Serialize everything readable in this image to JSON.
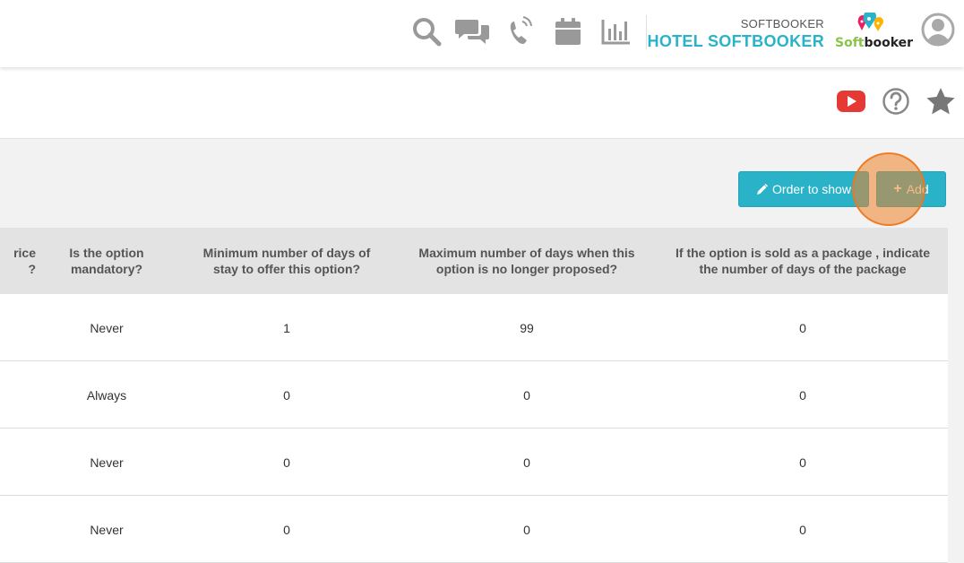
{
  "header": {
    "brand_small": "SOFTBOOKER",
    "brand_big": "HOTEL SOFTBOOKER",
    "logo_text_soft": "Soft",
    "logo_text_booker": "booker",
    "icons": [
      "search-icon",
      "chat-icon",
      "phone-icon",
      "calendar-icon",
      "chart-icon",
      "user-avatar-icon"
    ]
  },
  "subheader": {
    "icons": [
      "youtube-icon",
      "help-icon",
      "star-icon"
    ]
  },
  "toolbar": {
    "order_label": "Order to show",
    "add_label": "Add"
  },
  "table": {
    "headers": [
      "rice\n?",
      "Is the option\nmandatory?",
      "Minimum number of days of\nstay to offer this option?",
      "Maximum number of days when this\noption is no longer proposed?",
      "If the option is sold as a package , indicate\nthe number of days of the package"
    ],
    "rows": [
      [
        "",
        "Never",
        "1",
        "99",
        "0"
      ],
      [
        "",
        "Always",
        "0",
        "0",
        "0"
      ],
      [
        "",
        "Never",
        "0",
        "0",
        "0"
      ],
      [
        "",
        "Never",
        "0",
        "0",
        "0"
      ]
    ]
  },
  "colors": {
    "accent": "#2ab3c8",
    "youtube": "#e53935",
    "click_highlight": "#f08228"
  }
}
